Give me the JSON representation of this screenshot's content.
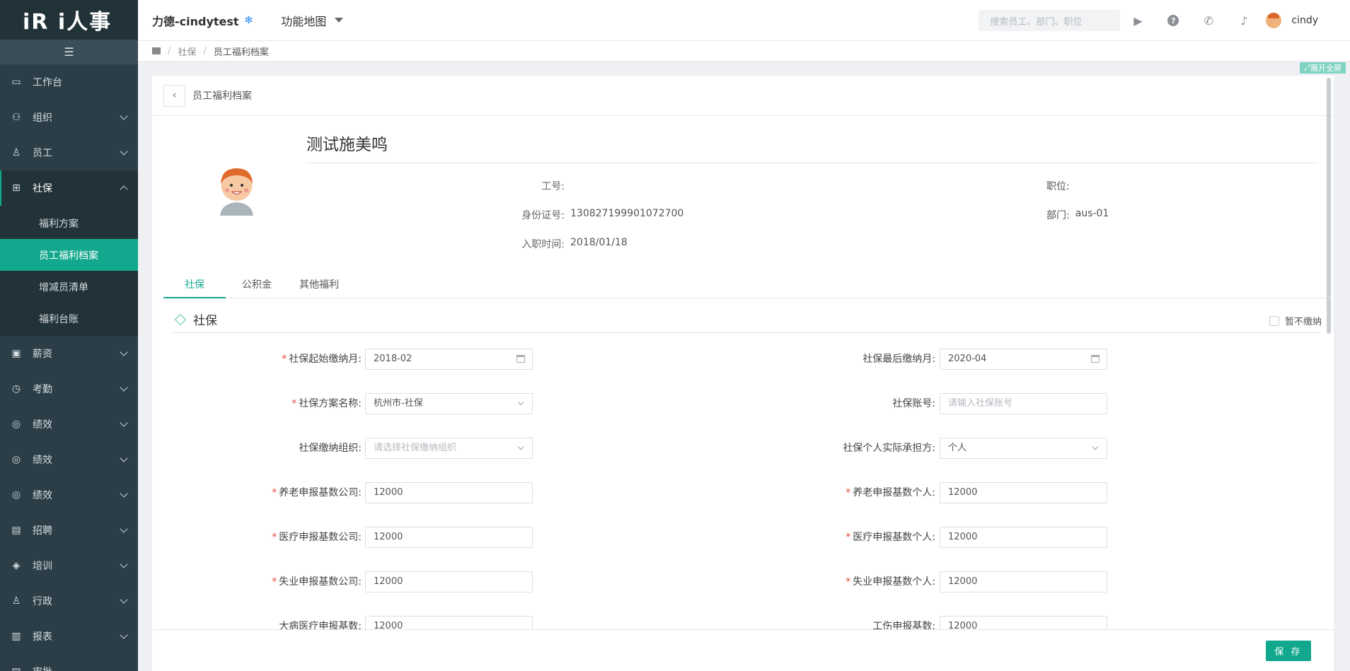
{
  "app": {
    "logo_text": "iR i人事"
  },
  "sidebar": {
    "collapse_icon": "menu-icon",
    "items": [
      {
        "label": "工作台",
        "icon": "monitor-icon"
      },
      {
        "label": "组织",
        "icon": "org-icon"
      },
      {
        "label": "员工",
        "icon": "user-icon"
      },
      {
        "label": "社保",
        "icon": "gift-icon",
        "expanded": true
      },
      {
        "label": "薪资",
        "icon": "wallet-icon"
      },
      {
        "label": "考勤",
        "icon": "clock-icon"
      },
      {
        "label": "绩效",
        "icon": "target-icon"
      },
      {
        "label": "绩效",
        "icon": "target-icon"
      },
      {
        "label": "绩效",
        "icon": "target-icon"
      },
      {
        "label": "招聘",
        "icon": "resume-icon"
      },
      {
        "label": "培训",
        "icon": "layers-icon"
      },
      {
        "label": "行政",
        "icon": "person-icon"
      },
      {
        "label": "报表",
        "icon": "chart-icon"
      },
      {
        "label": "审批",
        "icon": "doc-icon"
      }
    ],
    "sub_items": [
      {
        "label": "福利方案"
      },
      {
        "label": "员工福利档案",
        "active": true
      },
      {
        "label": "增减员清单"
      },
      {
        "label": "福利台账"
      }
    ]
  },
  "topbar": {
    "company": "力德-cindytest",
    "function_map": "功能地图",
    "search_placeholder": "搜索员工、部门、职位",
    "user_name": "cindy"
  },
  "breadcrumb": {
    "level1": "社保",
    "level2": "员工福利档案"
  },
  "fullscreen_label": "展开全屏",
  "page": {
    "title": "员工福利档案",
    "employee": {
      "name": "测试施美鸣",
      "emp_no_label": "工号:",
      "emp_no": "",
      "position_label": "职位:",
      "position": "",
      "id_label": "身份证号:",
      "id_no": "130827199901072700",
      "dept_label": "部门:",
      "dept": "aus-01",
      "hire_label": "入职时间:",
      "hire_date": "2018/01/18"
    },
    "tabs": [
      "社保",
      "公积金",
      "其他福利"
    ],
    "section_title": "社保",
    "suspend_label": "暂不缴纳",
    "form": {
      "start_month_label": "社保起始缴纳月:",
      "start_month": "2018-02",
      "end_month_label": "社保最后缴纳月:",
      "end_month": "2020-04",
      "plan_label": "社保方案名称:",
      "plan": "杭州市-社保",
      "account_label": "社保账号:",
      "account_placeholder": "请输入社保账号",
      "org_label": "社保缴纳组织:",
      "org_placeholder": "请选择社保缴纳组织",
      "bearer_label": "社保个人实际承担方:",
      "bearer": "个人",
      "pension_co_label": "养老申报基数公司:",
      "pension_co": "12000",
      "pension_ind_label": "养老申报基数个人:",
      "pension_ind": "12000",
      "medical_co_label": "医疗申报基数公司:",
      "medical_co": "12000",
      "medical_ind_label": "医疗申报基数个人:",
      "medical_ind": "12000",
      "unemp_co_label": "失业申报基数公司:",
      "unemp_co": "12000",
      "unemp_ind_label": "失业申报基数个人:",
      "unemp_ind": "12000",
      "serious_label": "大病医疗申报基数:",
      "serious": "12000",
      "injury_label": "工伤申报基数:",
      "injury": "12000"
    },
    "save_label": "保 存"
  }
}
